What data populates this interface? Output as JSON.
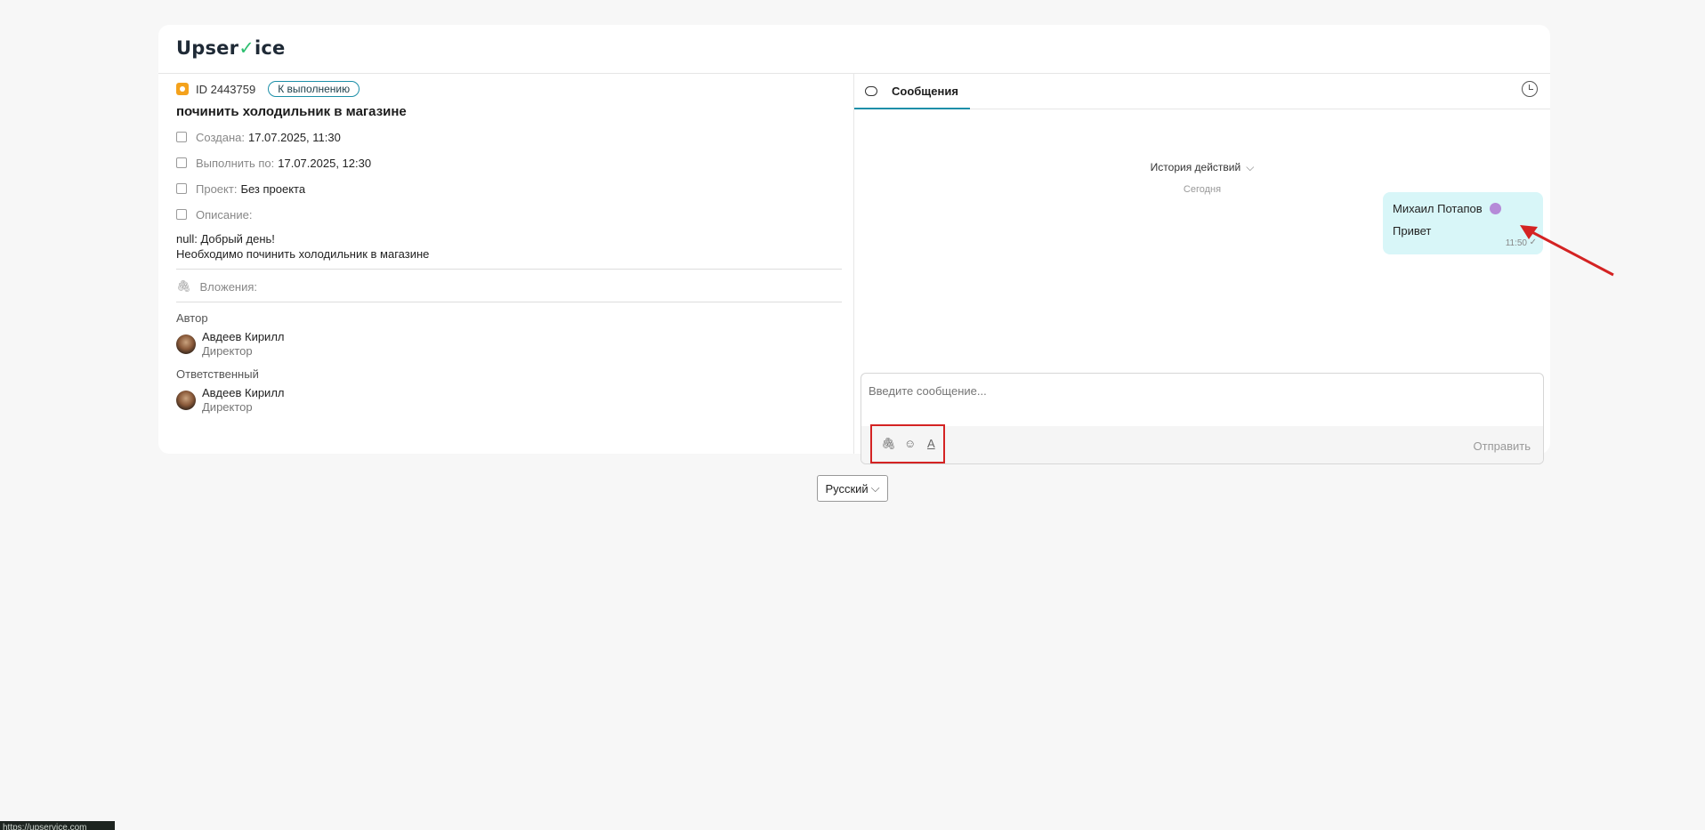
{
  "brand": {
    "name_part1": "Upser",
    "name_check": "✓",
    "name_part2": "ice",
    "accent": "#2fbf71"
  },
  "task": {
    "id": "ID 2443759",
    "status": "К выполнению",
    "title": "починить холодильник в магазине",
    "created_label": "Создана:",
    "created_value": "17.07.2025, 11:30",
    "due_label": "Выполнить по:",
    "due_value": "17.07.2025, 12:30",
    "project_label": "Проект:",
    "project_value": "Без проекта",
    "description_label": "Описание:",
    "description_line1": "null: Добрый день!",
    "description_line2": "Необходимо починить холодильник в магазине",
    "attachments_label": "Вложения:",
    "author_label": "Автор",
    "author_name": "Авдеев Кирилл",
    "author_role": "Директор",
    "assignee_label": "Ответственный",
    "assignee_name": "Авдеев Кирилл",
    "assignee_role": "Директор"
  },
  "chat": {
    "tab_label": "Сообщения",
    "history_toggle": "История действий",
    "day_label": "Сегодня",
    "message": {
      "sender": "Михаил Потапов",
      "text": "Привет",
      "time": "11:50"
    },
    "input_placeholder": "Введите сообщение...",
    "send_label": "Отправить",
    "tools": [
      "paperclip-icon",
      "smile-icon",
      "text-format-icon"
    ]
  },
  "language": {
    "selected": "Русский"
  },
  "statusbar": {
    "url": "https://upservice.com"
  },
  "colors": {
    "accent": "#1c8fa8",
    "bubble": "#d8f6f8",
    "highlight": "#d42323"
  }
}
